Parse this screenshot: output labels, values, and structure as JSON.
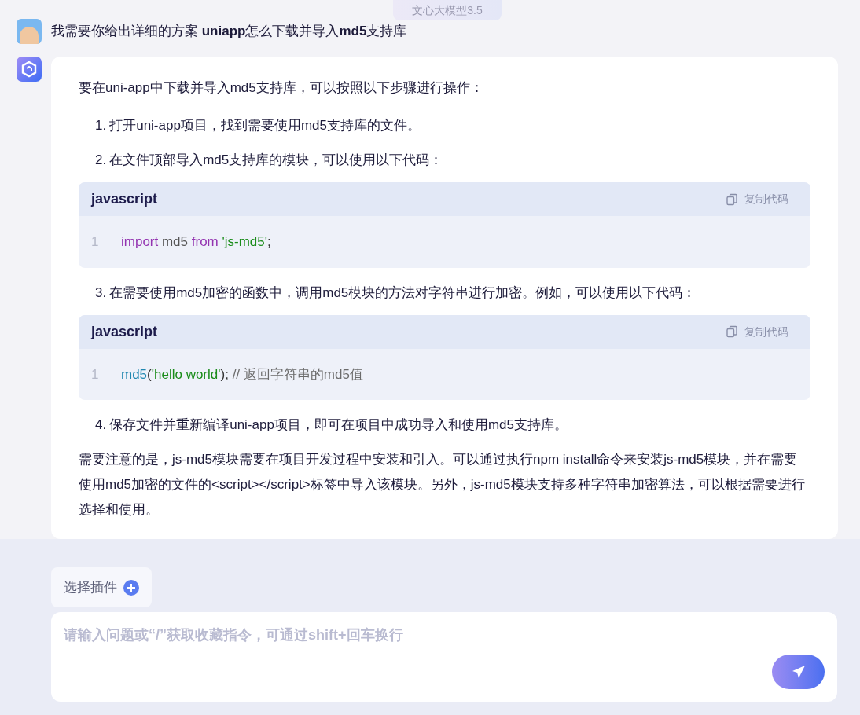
{
  "model_badge": "文心大模型3.5",
  "user_message": {
    "text": "我需要你给出详细的方案 **uniapp**怎么下载并导入**md5**支持库"
  },
  "answer": {
    "blocks": [
      {
        "kind": "paragraph",
        "text": "要在uni-app中下载并导入md5支持库，可以按照以下步骤进行操作："
      },
      {
        "kind": "list_item",
        "number": "1.",
        "text": "打开uni-app项目，找到需要使用md5支持库的文件。"
      },
      {
        "kind": "list_item",
        "number": "2.",
        "text": "在文件顶部导入md5支持库的模块，可以使用以下代码："
      },
      {
        "kind": "code",
        "language": "javascript",
        "copy_label": "复制代码",
        "lines": [
          {
            "number": "1",
            "tokens": [
              {
                "kind": "keyword",
                "text": "import"
              },
              {
                "kind": "plain",
                "text": " md5 "
              },
              {
                "kind": "keyword",
                "text": "from"
              },
              {
                "kind": "string",
                "text": " 'js-md5'"
              },
              {
                "kind": "punct",
                "text": ";"
              }
            ]
          }
        ]
      },
      {
        "kind": "list_item",
        "number": "3.",
        "text": "在需要使用md5加密的函数中，调用md5模块的方法对字符串进行加密。例如，可以使用以下代码："
      },
      {
        "kind": "code",
        "language": "javascript",
        "copy_label": "复制代码",
        "lines": [
          {
            "number": "1",
            "tokens": [
              {
                "kind": "function",
                "text": "md5"
              },
              {
                "kind": "punct",
                "text": "("
              },
              {
                "kind": "string",
                "text": "'hello world'"
              },
              {
                "kind": "punct",
                "text": ");"
              },
              {
                "kind": "comment",
                "text": " // 返回字符串的md5值"
              }
            ]
          }
        ]
      },
      {
        "kind": "list_item",
        "number": "4.",
        "text": "保存文件并重新编译uni-app项目，即可在项目中成功导入和使用md5支持库。"
      },
      {
        "kind": "paragraph",
        "text": "需要注意的是，js-md5模块需要在项目开发过程中安装和引入。可以通过执行npm install命令来安装js-md5模块，并在需要使用md5加密的文件的<script></script>标签中导入该模块。另外，js-md5模块支持多种字符串加密算法，可以根据需要进行选择和使用。"
      }
    ]
  },
  "plugin_button": {
    "label": "选择插件"
  },
  "input": {
    "placeholder": "请输入问题或“/”获取收藏指令，可通过shift+回车换行"
  }
}
